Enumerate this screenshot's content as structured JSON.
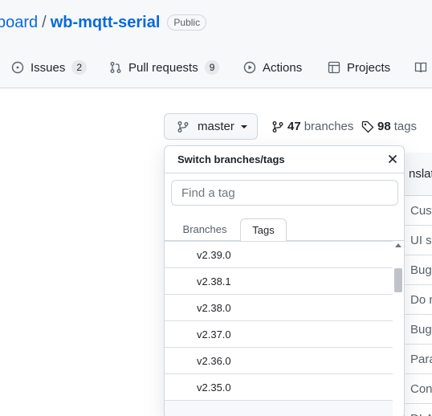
{
  "repo": {
    "owner": "board",
    "separator": "/",
    "name": "wb-mqtt-serial",
    "visibility": "Public"
  },
  "tabs": [
    {
      "label": "Issues",
      "count": "2",
      "icon": "issue-opened-icon"
    },
    {
      "label": "Pull requests",
      "count": "9",
      "icon": "git-pull-request-icon"
    },
    {
      "label": "Actions",
      "icon": "play-icon"
    },
    {
      "label": "Projects",
      "icon": "table-icon"
    },
    {
      "label": "",
      "icon": "book-icon"
    }
  ],
  "branch_selector": {
    "label": "master",
    "icon": "git-branch-icon"
  },
  "stats": {
    "branches_count": "47",
    "branches_label": "branches",
    "tags_count": "98",
    "tags_label": "tags"
  },
  "dropdown": {
    "title": "Switch branches/tags",
    "search_placeholder": "Find a tag",
    "tabs": [
      {
        "label": "Branches",
        "active": false
      },
      {
        "label": "Tags",
        "active": true
      }
    ],
    "items": [
      "v2.39.0",
      "v2.38.1",
      "v2.38.0",
      "v2.37.0",
      "v2.36.0",
      "v2.35.0",
      ""
    ],
    "scroll_position": 0.1
  },
  "background_table": {
    "header": "nslatio",
    "rows": [
      "Cust",
      "UI sc",
      "Bugf",
      "Do n",
      "Bugf",
      "Para",
      "Conf",
      "DLA"
    ]
  },
  "colors": {
    "link": "#0969da",
    "border": "#d0d7de",
    "muted": "#57606a",
    "header_bg": "#f6f8fa"
  }
}
